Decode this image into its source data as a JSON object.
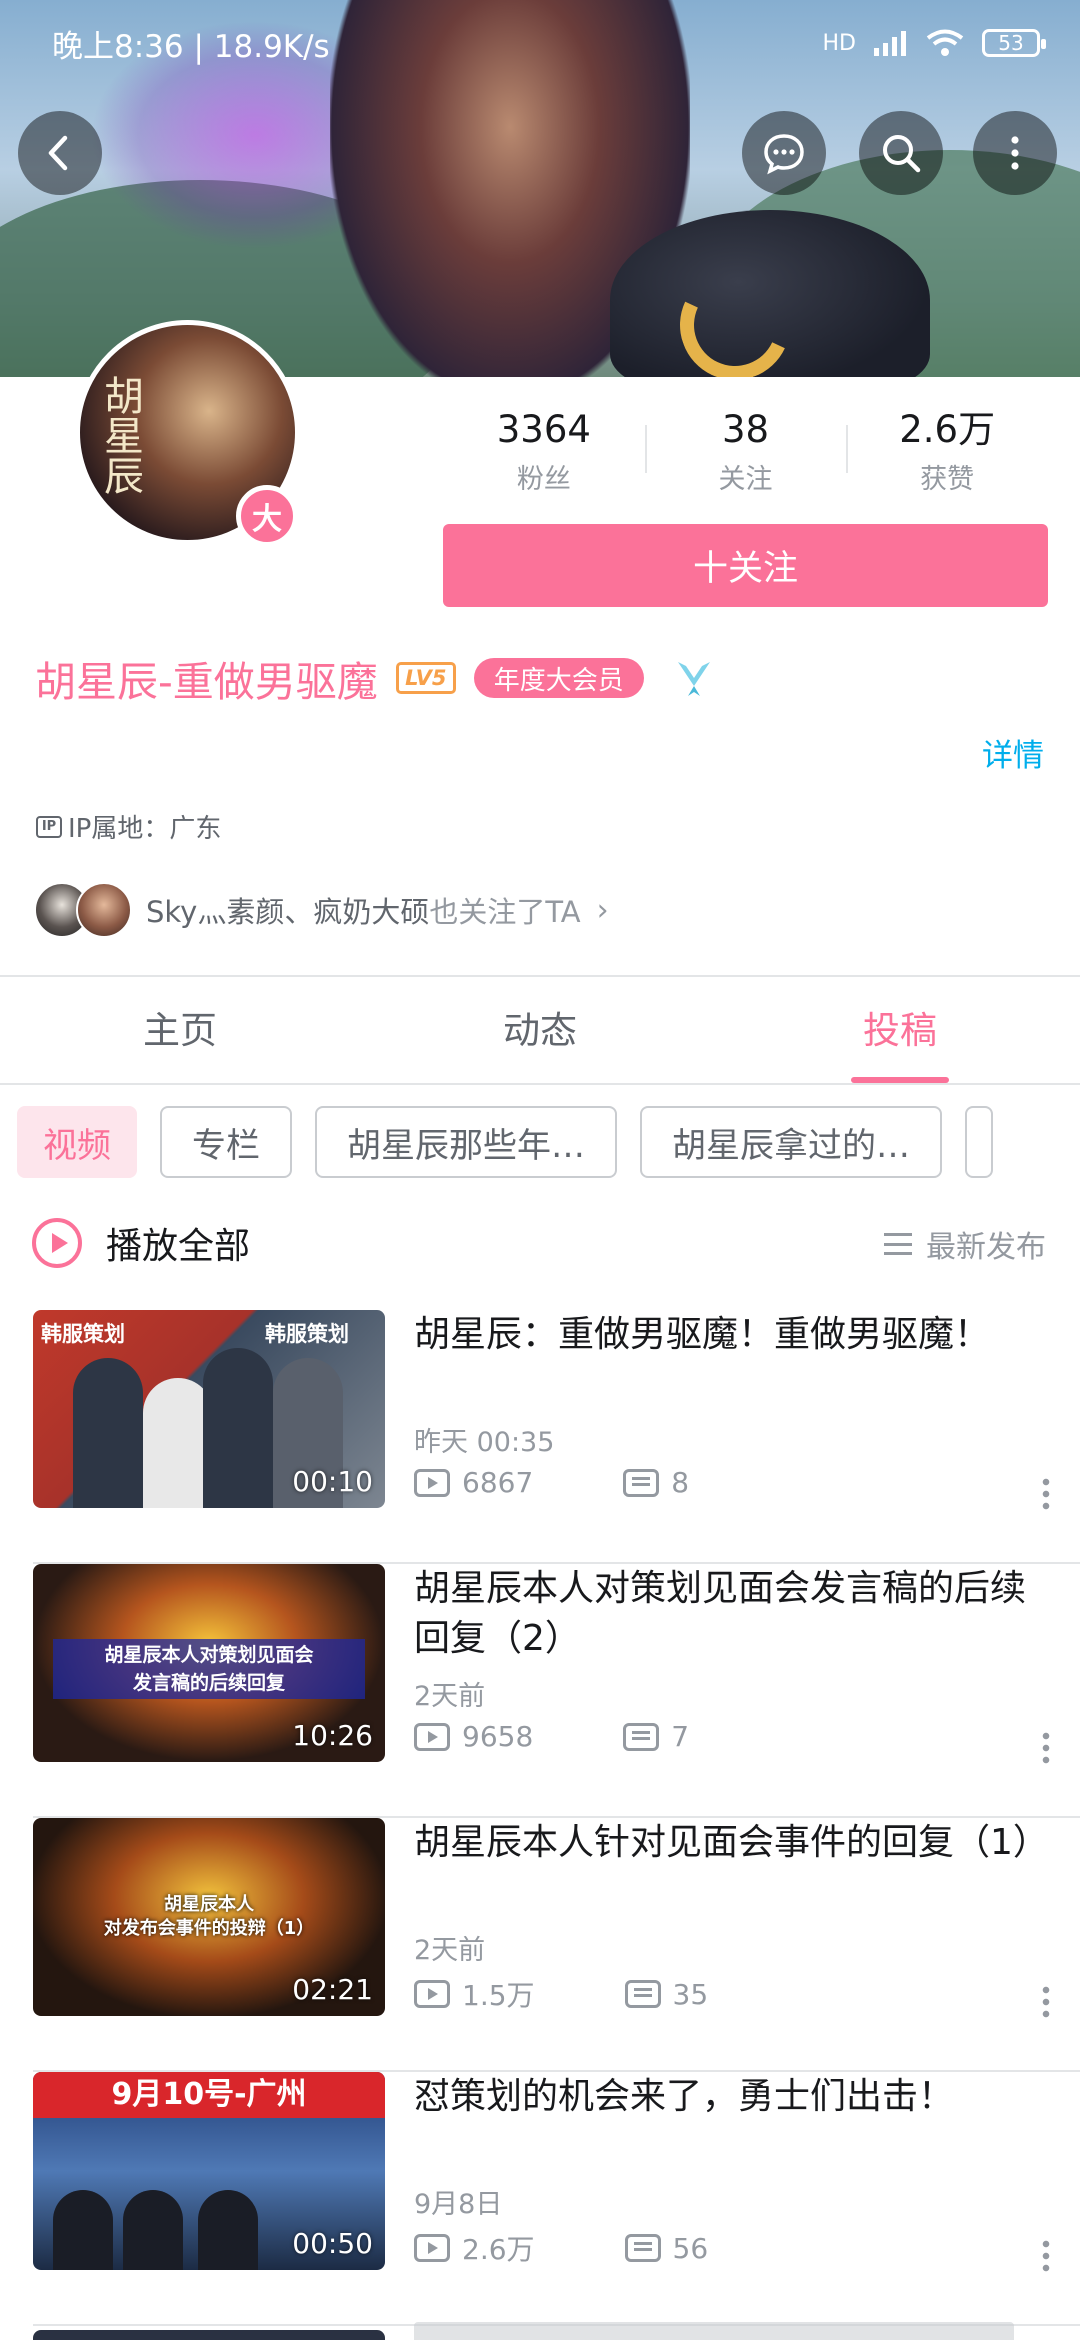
{
  "status_bar": {
    "time": "晚上8:36 | 18.9K/s",
    "network": "HD",
    "battery": "53"
  },
  "stats": [
    {
      "num": "3364",
      "label": "粉丝"
    },
    {
      "num": "38",
      "label": "关注"
    },
    {
      "num": "2.6万",
      "label": "获赞"
    }
  ],
  "follow_button": "十关注",
  "avatar_badge": "大",
  "avatar_text": "胡星辰",
  "name": "胡星辰-重做男驱魔",
  "level": "LV5",
  "vip": "年度大会员",
  "detail": "详情",
  "ip": {
    "icon": "IP",
    "label": "IP属地：广东"
  },
  "also_follow": {
    "names": "Sky灬素颜、疯奶大硕",
    "suffix": "也关注了TA"
  },
  "tabs": [
    "主页",
    "动态",
    "投稿"
  ],
  "filters": [
    "视频",
    "专栏",
    "胡星辰那些年…",
    "胡星辰拿过的…"
  ],
  "play_all": "播放全部",
  "sort": "最新发布",
  "videos": [
    {
      "title": "胡星辰：重做男驱魔！重做男驱魔！",
      "date": "昨天 00:35",
      "plays": "6867",
      "danmaku": "8",
      "duration": "00:10",
      "thumb_tags": [
        "韩服策划",
        "韩服策划"
      ]
    },
    {
      "title": "胡星辰本人对策划见面会发言稿的后续回复（2）",
      "date": "2天前",
      "plays": "9658",
      "danmaku": "7",
      "duration": "10:26",
      "thumb_text": [
        "胡星辰本人对策划见面会",
        "发言稿的后续回复"
      ]
    },
    {
      "title": "胡星辰本人针对见面会事件的回复（1）",
      "date": "2天前",
      "plays": "1.5万",
      "danmaku": "35",
      "duration": "02:21",
      "thumb_text": [
        "胡星辰本人",
        "对发布会事件的投辩（1）"
      ]
    },
    {
      "title": "怼策划的机会来了，勇士们出击！",
      "date": "9月8日",
      "plays": "2.6万",
      "danmaku": "56",
      "duration": "00:50",
      "thumb_text": [
        "9月10号-广州"
      ]
    }
  ],
  "colors": {
    "accent": "#fb7299",
    "link": "#00aeec",
    "level": "#f7a04a"
  }
}
